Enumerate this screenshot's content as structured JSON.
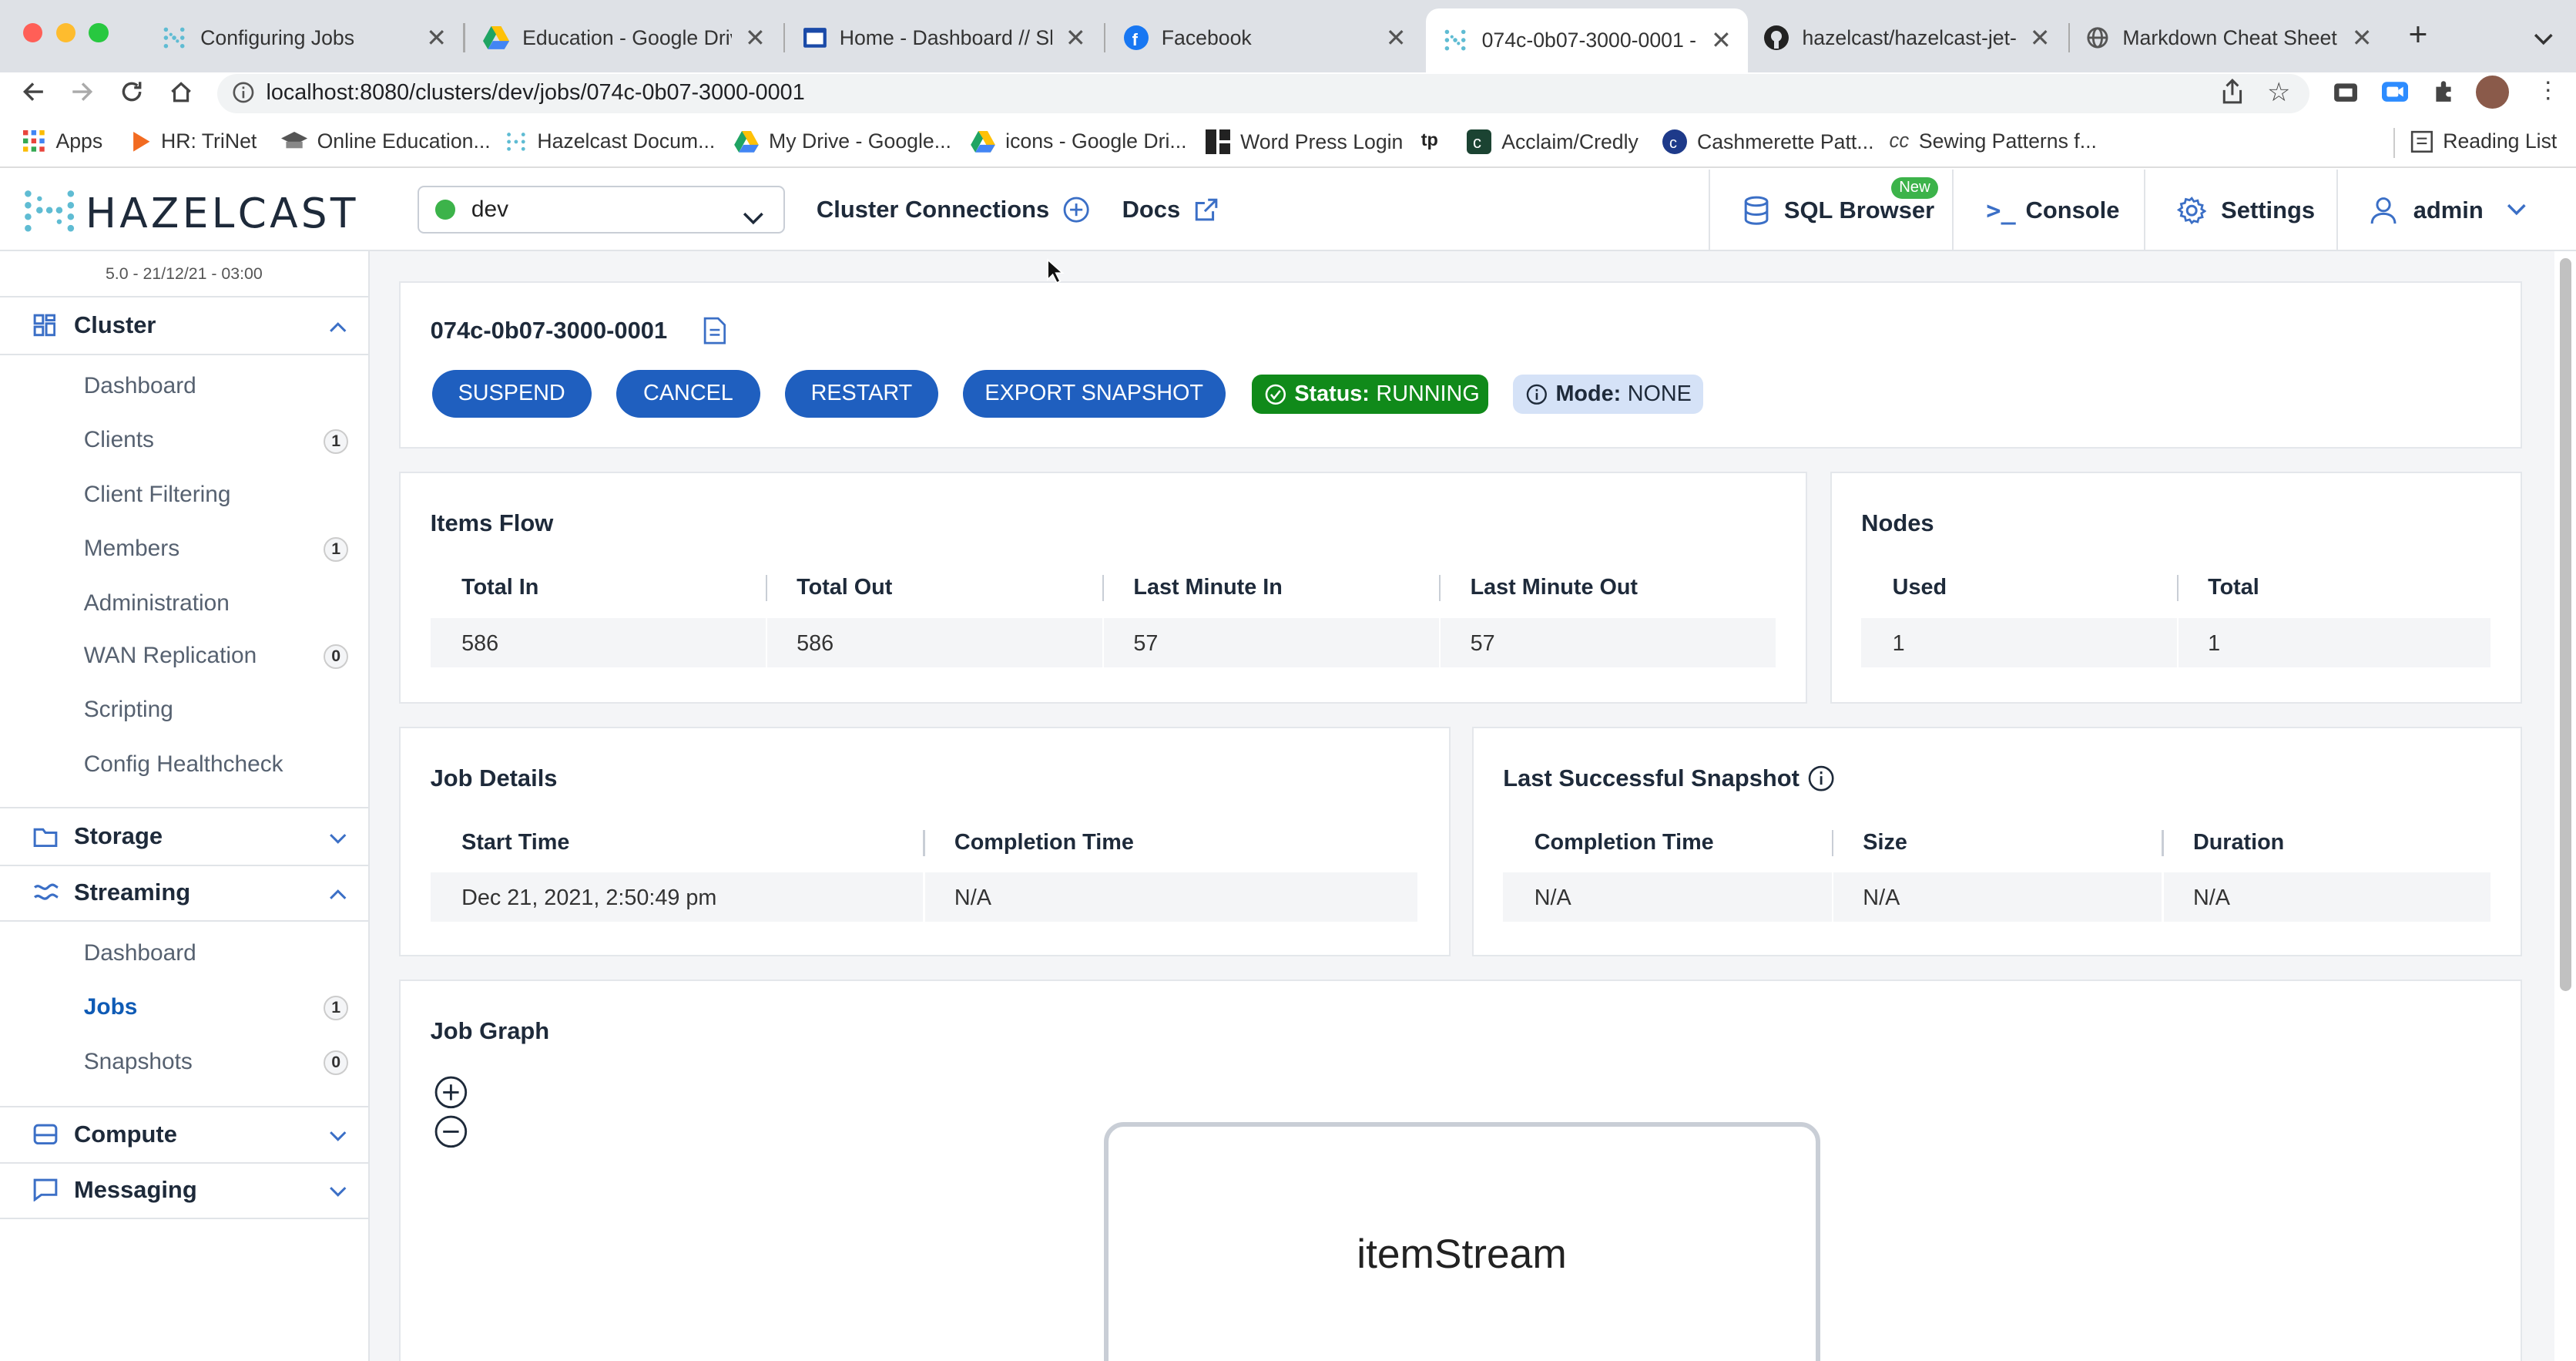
{
  "browser": {
    "tabs": [
      {
        "title": "Configuring Jobs",
        "icon": "hazelcast-favicon"
      },
      {
        "title": "Education - Google Drive",
        "icon": "google-drive-favicon"
      },
      {
        "title": "Home - Dashboard // Skil",
        "icon": "dashboard-favicon"
      },
      {
        "title": "Facebook",
        "icon": "facebook-favicon"
      },
      {
        "title": "074c-0b07-3000-0001 -",
        "icon": "hazelcast-favicon"
      },
      {
        "title": "hazelcast/hazelcast-jet-t",
        "icon": "github-favicon"
      },
      {
        "title": "Markdown Cheat Sheet",
        "icon": "globe-favicon"
      }
    ],
    "url": "localhost:8080/clusters/dev/jobs/074c-0b07-3000-0001",
    "bookmarks": [
      {
        "label": "Apps",
        "icon": "apps-grid-icon"
      },
      {
        "label": "HR: TriNet",
        "icon": "trinet-icon"
      },
      {
        "label": "Online Education...",
        "icon": "education-icon"
      },
      {
        "label": "Hazelcast Docum...",
        "icon": "hazelcast-icon"
      },
      {
        "label": "My Drive - Google...",
        "icon": "google-drive-icon"
      },
      {
        "label": "icons - Google Dri...",
        "icon": "google-drive-icon"
      },
      {
        "label": "Word Press Login",
        "icon": "wordpress-icon"
      },
      {
        "label": "",
        "icon": "typekit-icon"
      },
      {
        "label": "Acclaim/Credly",
        "icon": "credly-icon"
      },
      {
        "label": "Cashmerette Patt...",
        "icon": "cashmerette-icon"
      },
      {
        "label": "Sewing Patterns f...",
        "icon": "sewing-icon"
      }
    ],
    "reading_list": "Reading List"
  },
  "header": {
    "logo": "HAZELCAST",
    "cluster": "dev",
    "cluster_connections": "Cluster Connections",
    "docs": "Docs",
    "sql_browser": "SQL Browser",
    "sql_badge": "New",
    "console": "Console",
    "settings": "Settings",
    "user": "admin",
    "status_color": "#3cb34a",
    "accent": "#1f5fbf"
  },
  "sidebar": {
    "version": "5.0 - 21/12/21 - 03:00",
    "cluster": {
      "label": "Cluster",
      "items": [
        {
          "label": "Dashboard",
          "badge": ""
        },
        {
          "label": "Clients",
          "badge": "1"
        },
        {
          "label": "Client Filtering",
          "badge": ""
        },
        {
          "label": "Members",
          "badge": "1"
        },
        {
          "label": "Administration",
          "badge": ""
        },
        {
          "label": "WAN Replication",
          "badge": "0"
        },
        {
          "label": "Scripting",
          "badge": ""
        },
        {
          "label": "Config Healthcheck",
          "badge": ""
        }
      ]
    },
    "storage": {
      "label": "Storage"
    },
    "streaming": {
      "label": "Streaming",
      "items": [
        {
          "label": "Dashboard",
          "badge": ""
        },
        {
          "label": "Jobs",
          "badge": "1"
        },
        {
          "label": "Snapshots",
          "badge": "0"
        }
      ]
    },
    "compute": {
      "label": "Compute"
    },
    "messaging": {
      "label": "Messaging"
    }
  },
  "job": {
    "id": "074c-0b07-3000-0001",
    "buttons": {
      "suspend": "SUSPEND",
      "cancel": "CANCEL",
      "restart": "RESTART",
      "export": "EXPORT SNAPSHOT"
    },
    "status_label": "Status:",
    "status_value": "RUNNING",
    "mode_label": "Mode:",
    "mode_value": "NONE"
  },
  "items_flow": {
    "title": "Items Flow",
    "headers": [
      "Total In",
      "Total Out",
      "Last Minute In",
      "Last Minute Out"
    ],
    "values": [
      "586",
      "586",
      "57",
      "57"
    ]
  },
  "nodes": {
    "title": "Nodes",
    "headers": [
      "Used",
      "Total"
    ],
    "values": [
      "1",
      "1"
    ]
  },
  "job_details": {
    "title": "Job Details",
    "headers": [
      "Start Time",
      "Completion Time"
    ],
    "values": [
      "Dec 21, 2021, 2:50:49 pm",
      "N/A"
    ]
  },
  "snapshot": {
    "title": "Last Successful Snapshot",
    "headers": [
      "Completion Time",
      "Size",
      "Duration"
    ],
    "values": [
      "N/A",
      "N/A",
      "N/A"
    ]
  },
  "job_graph": {
    "title": "Job Graph",
    "node": "itemStream"
  }
}
